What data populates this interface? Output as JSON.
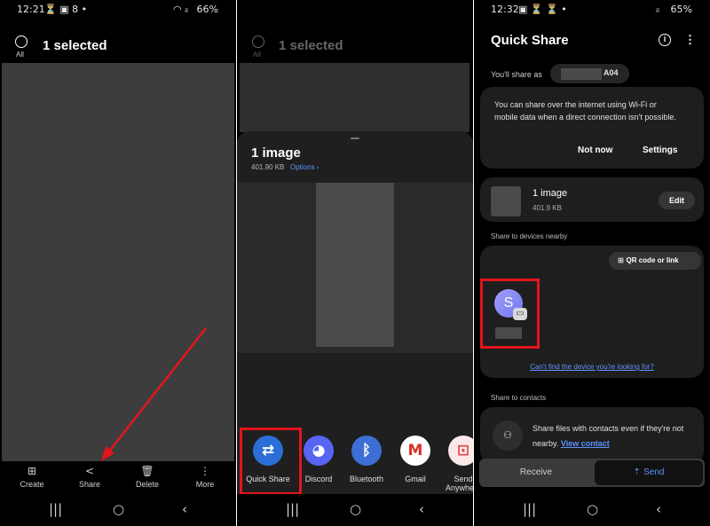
{
  "panel1": {
    "status": {
      "time": "12:21",
      "left_icons": "⏳ ▣ 8 •",
      "battery": "66%",
      "right_icons": "◠ ᵢₗ"
    },
    "header": {
      "selected_text": "1 selected",
      "all_label": "All"
    },
    "actions": [
      {
        "label": "Create",
        "icon": "create-icon",
        "glyph": "⊞"
      },
      {
        "label": "Share",
        "icon": "share-icon",
        "glyph": "<"
      },
      {
        "label": "Delete",
        "icon": "trash-icon",
        "glyph": "🗑"
      },
      {
        "label": "More",
        "icon": "more-vertical-icon",
        "glyph": "⋮"
      }
    ],
    "arrow_color": "#e2151c"
  },
  "panel2": {
    "header": {
      "selected_text": "1 selected",
      "all_label": "All"
    },
    "sheet": {
      "title": "1 image",
      "size": "401.90 KB",
      "options_label": "Options ›"
    },
    "apps": [
      {
        "label": "Quick Share",
        "icon": "quick-share-icon",
        "glyph": "⇄",
        "color": "#2b6fd6"
      },
      {
        "label": "Discord",
        "icon": "discord-icon",
        "glyph": "◕",
        "color": "#5865f2"
      },
      {
        "label": "Bluetooth",
        "icon": "bluetooth-icon",
        "glyph": "ᛒ",
        "color": "#3d6fd4"
      },
      {
        "label": "Gmail",
        "icon": "gmail-icon",
        "glyph": "M",
        "color": "#ffffff"
      },
      {
        "label": "Send Anywhere",
        "icon": "send-anywhere-icon",
        "glyph": "⊡",
        "color": "#fde8e8"
      }
    ],
    "highlight_color": "#e2151c"
  },
  "panel3": {
    "status": {
      "time": "12:32",
      "left_icons": "▣ ⏳ ⏳ •",
      "battery": "65%",
      "right_icons": "ᵢₗ"
    },
    "title": "Quick Share",
    "share_as_label": "You'll share as",
    "device_suffix": "A04",
    "notice": {
      "text": "You can share over the internet using Wi-Fi or mobile data when a direct connection isn't possible.",
      "not_now": "Not now",
      "settings": "Settings"
    },
    "file": {
      "title": "1 image",
      "size": "401.9 KB",
      "edit": "Edit"
    },
    "nearby_label": "Share to devices nearby",
    "qr_label": "QR code or link",
    "device_avatar_letter": "S",
    "cant_find": "Can't find the device you're looking for?",
    "contacts_label": "Share to contacts",
    "contacts_text": "Share files with contacts even if they're not nearby.",
    "view_contact": "View contact",
    "receive": "Receive",
    "send": "Send",
    "accent_color": "#5d93ff"
  }
}
